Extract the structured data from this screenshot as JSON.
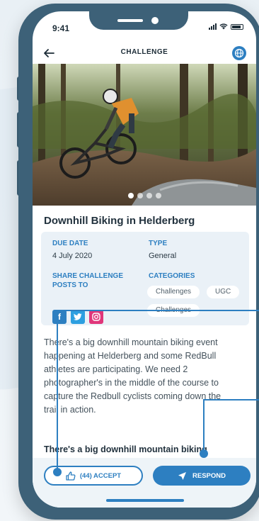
{
  "status_bar": {
    "time": "9:41"
  },
  "header": {
    "title": "CHALLENGE"
  },
  "hero": {
    "slides": 4,
    "active_slide": 1
  },
  "challenge": {
    "title": "Downhill Biking in Helderberg",
    "due_date_label": "DUE DATE",
    "due_date": "4 July 2020",
    "type_label": "TYPE",
    "type": "General",
    "share_label_line1": "SHARE CHALLENGE",
    "share_label_line2": "POSTS TO",
    "categories_label": "CATEGORIES",
    "categories": [
      "Challenges",
      "UGC",
      "Challenges"
    ],
    "social": [
      "facebook",
      "twitter",
      "instagram"
    ],
    "description_lines": [
      "There's a big downhill mountain biking event",
      "happening at Helderberg and some RedBull",
      "athletes are participating. We need 2",
      "photographer's in the middle of the course to",
      "capture the Redbull cyclists coming down the",
      "trail in action."
    ],
    "subheading": "There's a big downhill mountain biking"
  },
  "actions": {
    "accept_label": "(44) ACCEPT",
    "respond_label": "RESPOND"
  },
  "colors": {
    "phone_frame": "#3d6178",
    "accent": "#2d7fc1",
    "card_bg": "#eaf1f7",
    "instagram": "#e0367a"
  }
}
